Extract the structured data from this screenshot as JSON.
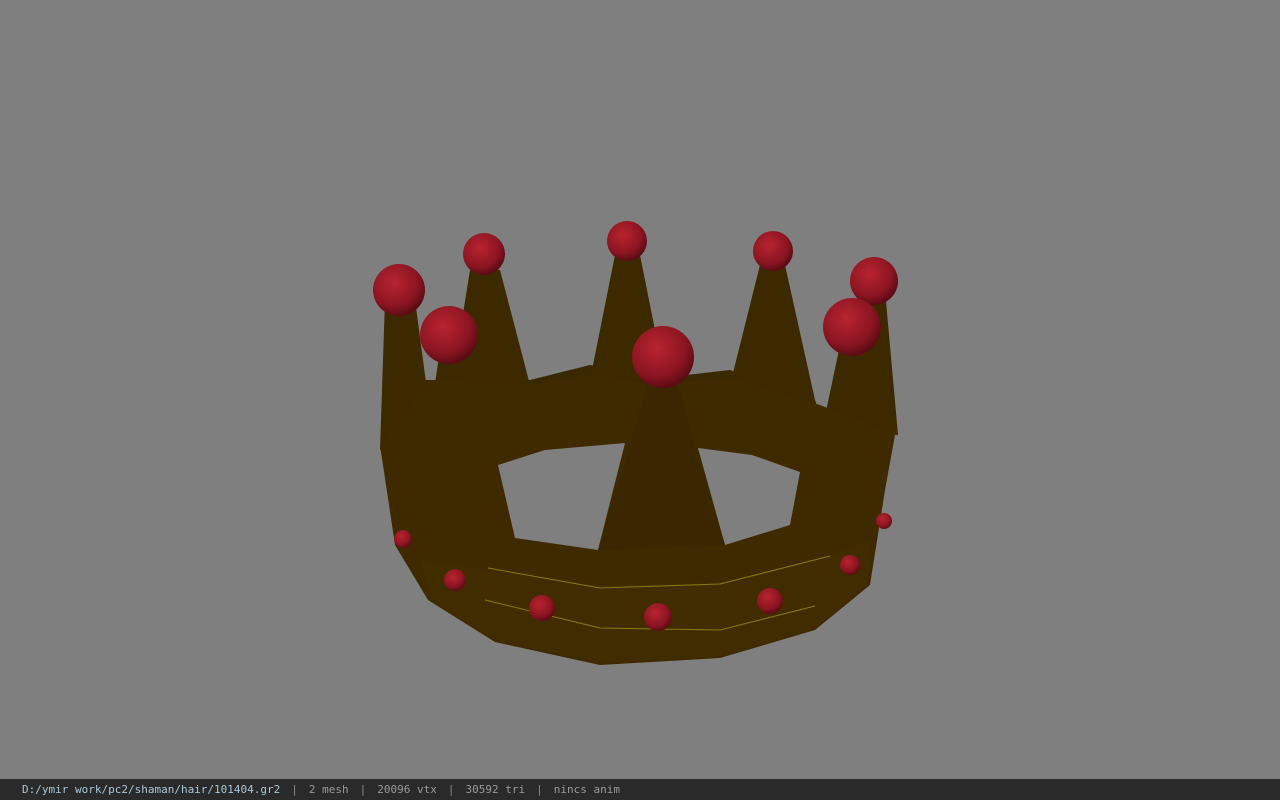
{
  "viewport": {
    "background": "#7f7f7f",
    "model": "crown"
  },
  "colors": {
    "crown_gold": "#3f2a00",
    "crown_edge": "#8a7a10",
    "gem_red": "#9a1a26"
  },
  "status_bar": {
    "file_path": "D:/ymir work/pc2/shaman/hair/101404.gr2",
    "separator": "|",
    "mesh": "2 mesh",
    "vertices": "20096 vtx",
    "triangles": "30592 tri",
    "anim": "nincs anim"
  }
}
